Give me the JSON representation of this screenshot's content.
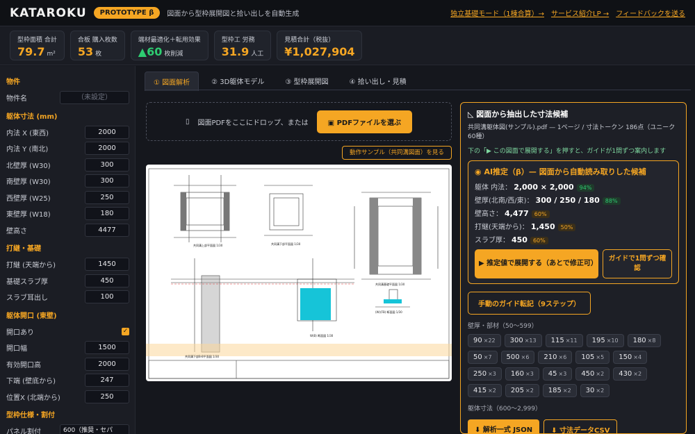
{
  "header": {
    "logo": "KATAROKU",
    "badge": "PROTOTYPE β",
    "tagline": "図面から型枠展開図と拾い出しを自動生成",
    "links": [
      "独立基礎モード（1棟合算）→",
      "サービス紹介LP →",
      "フィードバックを送る"
    ]
  },
  "stats": [
    {
      "label": "型枠面積 合計",
      "value": "79.7",
      "unit": "m²"
    },
    {
      "label": "合板 購入枚数",
      "value": "53",
      "unit": "枚"
    },
    {
      "label": "端材最適化＋転用効果",
      "value": "60",
      "prefix": "▲",
      "unit": "枚削減"
    },
    {
      "label": "型枠工 労務",
      "value": "31.9",
      "unit": "人工"
    },
    {
      "label": "見積合計（税抜）",
      "value": "¥1,027,904",
      "unit": ""
    }
  ],
  "sidebar": {
    "property": {
      "title": "物件",
      "name_label": "物件名",
      "name_placeholder": "（未設定）"
    },
    "body": {
      "title": "躯体寸法 (mm)",
      "fields": [
        {
          "label": "内法 X (東西)",
          "value": "2000"
        },
        {
          "label": "内法 Y (南北)",
          "value": "2000"
        },
        {
          "label": "北壁厚 (W30)",
          "value": "300"
        },
        {
          "label": "南壁厚 (W30)",
          "value": "300"
        },
        {
          "label": "西壁厚 (W25)",
          "value": "250"
        },
        {
          "label": "東壁厚 (W18)",
          "value": "180"
        },
        {
          "label": "壁高さ",
          "value": "4477"
        }
      ]
    },
    "pour": {
      "title": "打継・基礎",
      "fields": [
        {
          "label": "打継 (天端から)",
          "value": "1450"
        },
        {
          "label": "基礎スラブ厚",
          "value": "450"
        },
        {
          "label": "スラブ耳出し",
          "value": "100"
        }
      ]
    },
    "opening": {
      "title": "躯体開口 (東壁)",
      "has_label": "開口あり",
      "fields": [
        {
          "label": "開口幅",
          "value": "1500"
        },
        {
          "label": "有効開口高",
          "value": "2000"
        },
        {
          "label": "下端 (壁底から)",
          "value": "247"
        },
        {
          "label": "位置X (北端から)",
          "value": "250"
        }
      ]
    },
    "formwork": {
      "title": "型枠仕様・割付",
      "panel_label": "パネル割付",
      "panel_value": "600（推奨・セパ"
    }
  },
  "tabs": [
    "① 図面解析",
    "② 3D躯体モデル",
    "③ 型枠展開図",
    "④ 拾い出し・見積"
  ],
  "drop": {
    "text": "図面PDFをここにドロップ、または",
    "button": "PDFファイルを選ぶ",
    "sample": "動作サンプル（共同溝図面）を見る"
  },
  "drawing": {
    "labels": [
      "共同溝上部平面図 1/30",
      "共同溝下部平面図 1/30",
      "共同溝基礎平面図 1/30",
      "共同溝下部B-B平面図 1/30",
      "(W)(FB) 断面図 1/30",
      "W(B) 断面図 1/30"
    ]
  },
  "panel": {
    "title": "図面から抽出した寸法候補",
    "file": "共同溝躯体図(サンプル).pdf — 1ページ / 寸法トークン 186点（ユニーク 60種）",
    "guide": "下の「▶ この図面で展開する」を押すと、ガイドが1問ずつ案内します",
    "ai": {
      "title": "AI推定（β）— 図面から自動読み取りした候補",
      "rows": [
        {
          "label": "躯体 内法：",
          "value": "2,000 × 2,000",
          "conf": "94%",
          "level": "hi"
        },
        {
          "label": "壁厚(北南/西/東)：",
          "value": "300 / 250 / 180",
          "conf": "88%",
          "level": "hi"
        },
        {
          "label": "壁高さ：",
          "value": "4,477",
          "conf": "60%",
          "level": "md"
        },
        {
          "label": "打継(天端から)：",
          "value": "1,450",
          "conf": "50%",
          "level": "md"
        },
        {
          "label": "スラブ厚：",
          "value": "450",
          "conf": "60%",
          "level": "md"
        }
      ],
      "expand_button": "▶ 推定値で展開する（あとで修正可）",
      "guide_button": "ガイドで1問ずつ確認"
    },
    "manual_button": "手動のガイド転記（9ステップ）",
    "wall_label": "壁厚・部材（50〜599）",
    "chips": [
      {
        "v": "90",
        "c": "×22"
      },
      {
        "v": "300",
        "c": "×13"
      },
      {
        "v": "115",
        "c": "×11"
      },
      {
        "v": "195",
        "c": "×10"
      },
      {
        "v": "180",
        "c": "×8"
      },
      {
        "v": "50",
        "c": "×7"
      },
      {
        "v": "500",
        "c": "×6"
      },
      {
        "v": "210",
        "c": "×6"
      },
      {
        "v": "105",
        "c": "×5"
      },
      {
        "v": "150",
        "c": "×4"
      },
      {
        "v": "250",
        "c": "×3"
      },
      {
        "v": "160",
        "c": "×3"
      },
      {
        "v": "45",
        "c": "×3"
      },
      {
        "v": "450",
        "c": "×2"
      },
      {
        "v": "430",
        "c": "×2"
      },
      {
        "v": "415",
        "c": "×2"
      },
      {
        "v": "205",
        "c": "×2"
      },
      {
        "v": "185",
        "c": "×2"
      },
      {
        "v": "30",
        "c": "×2"
      }
    ],
    "body_label": "躯体寸法（600〜2,999）",
    "json_button": "⬇ 解析一式 JSON",
    "csv_button": "⬇ 寸法データCSV"
  },
  "colors": {
    "accent": "#f5a623",
    "bg": "#15171d",
    "success": "#2ecc71"
  }
}
